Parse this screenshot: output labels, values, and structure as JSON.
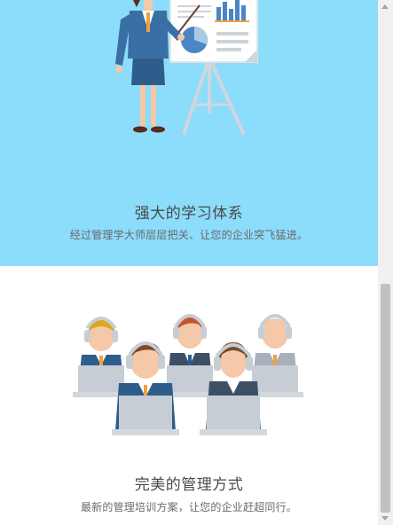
{
  "features": [
    {
      "title": "强大的学习体系",
      "description": "经过管理学大师层层把关、让您的企业突飞猛进。"
    },
    {
      "title": "完美的管理方式",
      "description": "最新的管理培训方案，让您的企业赶超同行。"
    }
  ],
  "colors": {
    "blue_section": "#8cdcfb",
    "suit_blue": "#2e5d8c",
    "monitor": "#c7cdd4"
  },
  "icons": {
    "illustration_1": "presenter-with-chart-board",
    "illustration_2": "call-center-team-with-headsets"
  }
}
